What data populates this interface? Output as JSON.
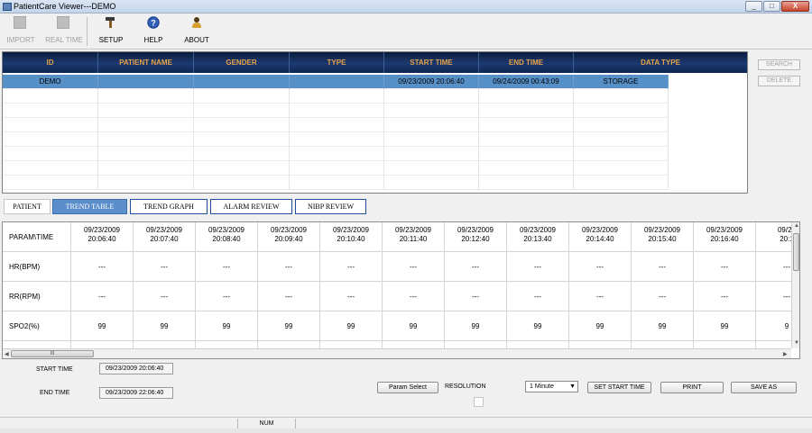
{
  "window": {
    "title": "PatientCare Viewer---DEMO",
    "controls": [
      "_",
      "□",
      "X"
    ]
  },
  "toolbar": {
    "items": [
      {
        "label": "IMPORT",
        "icon": "import-icon",
        "enabled": false
      },
      {
        "label": "REAL TIME",
        "icon": "realtime-icon",
        "enabled": false
      },
      {
        "label": "SETUP",
        "icon": "hammer-icon",
        "enabled": true
      },
      {
        "label": "HELP",
        "icon": "help-icon",
        "enabled": true
      },
      {
        "label": "ABOUT",
        "icon": "about-icon",
        "enabled": true
      }
    ]
  },
  "patient_table": {
    "columns": [
      "ID",
      "PATIENT NAME",
      "GENDER",
      "TYPE",
      "START TIME",
      "END TIME",
      "DATA TYPE"
    ],
    "rows": [
      {
        "id": "DEMO",
        "name": "",
        "gender": "",
        "type": "",
        "start": "09/23/2009 20:06:40",
        "end": "09/24/2009 00:43:09",
        "data_type": "STORAGE"
      }
    ],
    "header_color": "#102a55",
    "header_text_color": "#e6a34a",
    "selected_color": "#5790c7"
  },
  "side_buttons": {
    "search": "SEARCH",
    "delete": "DELETE"
  },
  "tabs": [
    {
      "label": "PATIENT",
      "active": false
    },
    {
      "label": "TREND TABLE",
      "active": true
    },
    {
      "label": "TREND GRAPH",
      "active": false
    },
    {
      "label": "ALARM REVIEW",
      "active": false
    },
    {
      "label": "NIBP REVIEW",
      "active": false
    }
  ],
  "trend_table": {
    "corner_label": "PARAM\\TIME",
    "times": [
      [
        "09/23/2009",
        "20:06:40"
      ],
      [
        "09/23/2009",
        "20:07:40"
      ],
      [
        "09/23/2009",
        "20:08:40"
      ],
      [
        "09/23/2009",
        "20:09:40"
      ],
      [
        "09/23/2009",
        "20:10:40"
      ],
      [
        "09/23/2009",
        "20:11:40"
      ],
      [
        "09/23/2009",
        "20:12:40"
      ],
      [
        "09/23/2009",
        "20:13:40"
      ],
      [
        "09/23/2009",
        "20:14:40"
      ],
      [
        "09/23/2009",
        "20:15:40"
      ],
      [
        "09/23/2009",
        "20:16:40"
      ],
      [
        "09/23",
        "20:1"
      ]
    ],
    "rows": [
      {
        "label": "HR(BPM)",
        "values": [
          "---",
          "---",
          "---",
          "---",
          "---",
          "---",
          "---",
          "---",
          "---",
          "---",
          "---",
          "---"
        ]
      },
      {
        "label": "RR(RPM)",
        "values": [
          "---",
          "---",
          "---",
          "---",
          "---",
          "---",
          "---",
          "---",
          "---",
          "---",
          "---",
          "---"
        ]
      },
      {
        "label": "SPO2(%)",
        "values": [
          "99",
          "99",
          "99",
          "99",
          "99",
          "99",
          "99",
          "99",
          "99",
          "99",
          "99",
          "9"
        ]
      }
    ],
    "hscroll_label": "III"
  },
  "controls": {
    "start_time_label": "START TIME",
    "start_time_value": "09/23/2009 20:06:40",
    "end_time_label": "END TIME",
    "end_time_value": "09/23/2009 22:06:40",
    "param_select": "Param Select",
    "resolution_label": "RESOLUTION",
    "resolution_value": "1 Minute",
    "set_start_time": "SET START TIME",
    "print": "PRINT",
    "save_as": "SAVE AS"
  },
  "status": {
    "num": "NUM"
  }
}
